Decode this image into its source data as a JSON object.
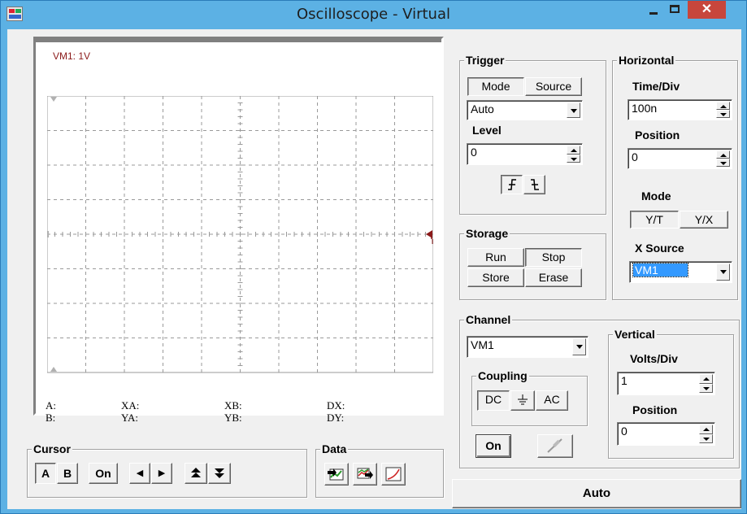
{
  "window": {
    "title": "Oscilloscope - Virtual",
    "close_glyph": "✕"
  },
  "scope": {
    "channel_label": "VM1: 1V",
    "readouts": {
      "a": "A:",
      "b": "B:",
      "xa": "XA:",
      "ya": "YA:",
      "xb": "XB:",
      "yb": "YB:",
      "dx": "DX:",
      "dy": "DY:"
    },
    "trace_color": "#8b1a1a"
  },
  "trigger": {
    "legend": "Trigger",
    "mode_label": "Mode",
    "source_label": "Source",
    "mode_value": "Auto",
    "level_label": "Level",
    "level_value": "0",
    "edge_rising_glyph": "⨍",
    "edge_falling_glyph": "⨍"
  },
  "storage": {
    "legend": "Storage",
    "run": "Run",
    "stop": "Stop",
    "store": "Store",
    "erase": "Erase"
  },
  "horizontal": {
    "legend": "Horizontal",
    "time_div_label": "Time/Div",
    "time_div_value": "100n",
    "position_label": "Position",
    "position_value": "0",
    "mode_label": "Mode",
    "yt": "Y/T",
    "yx": "Y/X",
    "xsource_label": "X Source",
    "xsource_value": "VM1"
  },
  "channel": {
    "legend": "Channel",
    "channel_value": "VM1",
    "coupling_legend": "Coupling",
    "dc": "DC",
    "gnd": "⏚",
    "ac": "AC",
    "on": "On"
  },
  "vertical": {
    "legend": "Vertical",
    "volts_div_label": "Volts/Div",
    "volts_div_value": "1",
    "position_label": "Position",
    "position_value": "0"
  },
  "cursor": {
    "legend": "Cursor",
    "a": "A",
    "b": "B",
    "on": "On",
    "left": "◀",
    "right": "▶",
    "up": "⯭",
    "down": "⯯"
  },
  "data": {
    "legend": "Data"
  },
  "auto_button": "Auto"
}
